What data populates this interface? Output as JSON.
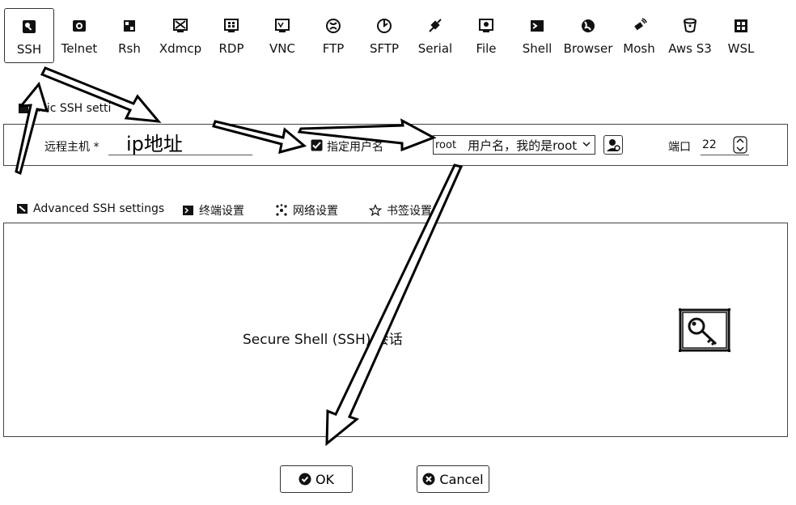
{
  "protocol_tabs": [
    {
      "label": "SSH",
      "icon": "ssh-icon",
      "active": true
    },
    {
      "label": "Telnet",
      "icon": "telnet-icon",
      "active": false
    },
    {
      "label": "Rsh",
      "icon": "rsh-icon",
      "active": false
    },
    {
      "label": "Xdmcp",
      "icon": "xdmcp-icon",
      "active": false
    },
    {
      "label": "RDP",
      "icon": "rdp-icon",
      "active": false
    },
    {
      "label": "VNC",
      "icon": "vnc-icon",
      "active": false
    },
    {
      "label": "FTP",
      "icon": "ftp-icon",
      "active": false
    },
    {
      "label": "SFTP",
      "icon": "sftp-icon",
      "active": false
    },
    {
      "label": "Serial",
      "icon": "serial-icon",
      "active": false
    },
    {
      "label": "File",
      "icon": "file-icon",
      "active": false
    },
    {
      "label": "Shell",
      "icon": "shell-icon",
      "active": false
    },
    {
      "label": "Browser",
      "icon": "browser-icon",
      "active": false
    },
    {
      "label": "Mosh",
      "icon": "mosh-icon",
      "active": false
    },
    {
      "label": "Aws S3",
      "icon": "aws-s3-icon",
      "active": false
    },
    {
      "label": "WSL",
      "icon": "wsl-icon",
      "active": false
    }
  ],
  "basic_settings": {
    "title": "asic SSH setti",
    "remote_host_label": "远程主机 *",
    "remote_host_value": "ip地址",
    "specify_username_label": "指定用户名",
    "specify_username_checked": true,
    "username_value": "root",
    "username_note": "用户名，我的是root",
    "port_label": "端口",
    "port_value": "22"
  },
  "settings_tabs": [
    {
      "label": "Advanced SSH settings",
      "icon": "advanced-ssh-icon"
    },
    {
      "label": "终端设置",
      "icon": "terminal-settings-icon"
    },
    {
      "label": "网络设置",
      "icon": "network-settings-icon"
    },
    {
      "label": "书签设置",
      "icon": "bookmark-star-icon"
    }
  ],
  "content": {
    "session_title": "Secure Shell (SSH) 会话",
    "icon": "key-icon"
  },
  "buttons": {
    "ok_label": "OK",
    "cancel_label": "Cancel"
  },
  "colors": {
    "border": "#444444",
    "icon": "#111111",
    "background": "#ffffff"
  }
}
